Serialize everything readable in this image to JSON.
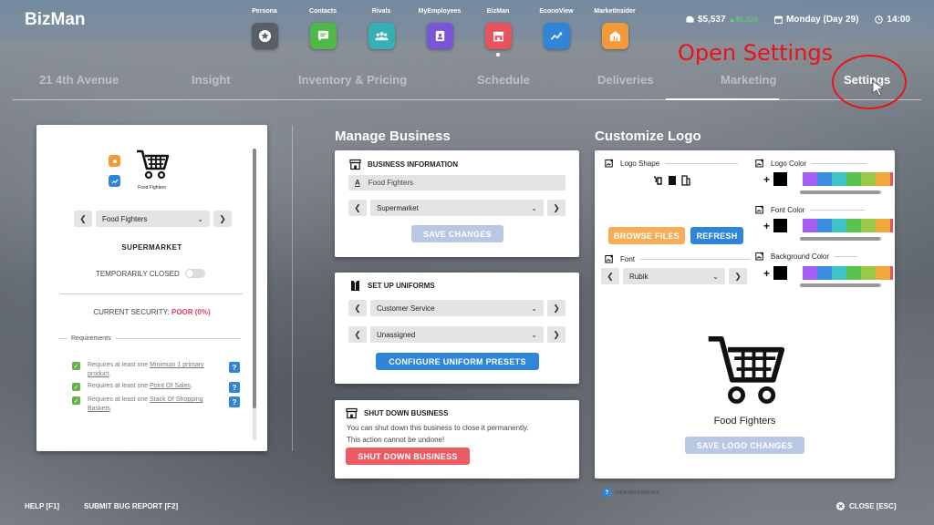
{
  "app": {
    "brand": "BizMan",
    "apps": [
      {
        "label": "Persona",
        "icon": "persona-icon",
        "color": "#5a5f66"
      },
      {
        "label": "Contacts",
        "icon": "contacts-icon",
        "color": "#4fb848"
      },
      {
        "label": "Rivals",
        "icon": "rivals-icon",
        "color": "#35b0b4"
      },
      {
        "label": "MyEmployees",
        "icon": "employees-icon",
        "color": "#7b55d8"
      },
      {
        "label": "BizMan",
        "icon": "bizman-icon",
        "color": "#e8545e"
      },
      {
        "label": "EconoView",
        "icon": "econoview-icon",
        "color": "#2f86d8"
      },
      {
        "label": "MarketInsider",
        "icon": "marketinsider-icon",
        "color": "#f29a3a"
      }
    ],
    "money": "$5,537",
    "money_change": "▲$5,334",
    "day": "Monday (Day 29)",
    "time": "14:00"
  },
  "tabs": [
    "21 4th Avenue",
    "Insight",
    "Inventory & Pricing",
    "Schedule",
    "Deliveries",
    "Marketing",
    "Settings"
  ],
  "annotation": "Open Settings",
  "left_panel": {
    "logo_name": "Food Fighters",
    "business_select": "Food Fighters",
    "type": "SUPERMARKET",
    "closed_label": "TEMPORARILY CLOSED",
    "security_label": "CURRENT SECURITY:",
    "security_value": "POOR (0%)",
    "requirements_label": "Requirements",
    "requirements": [
      {
        "prefix": "Requires at least one ",
        "link": "Minimum 1 primary product",
        "suffix": "."
      },
      {
        "prefix": "Requires at least one ",
        "link": "Point Of Sales",
        "suffix": "."
      },
      {
        "prefix": "Requires at least one ",
        "link": "Stack Of Shopping Baskets",
        "suffix": "."
      }
    ],
    "help_glyph": "?"
  },
  "manage": {
    "title": "Manage Business",
    "info_head": "BUSINESS INFORMATION",
    "name_value": "Food Fighters",
    "name_prefix": "A",
    "type_select": "Supermarket",
    "save_changes": "SAVE CHANGES",
    "uniforms_head": "SET UP UNIFORMS",
    "uniform_role": "Customer Service",
    "uniform_preset": "Unassigned",
    "configure": "CONFIGURE UNIFORM PRESETS",
    "shutdown_head": "SHUT DOWN BUSINESS",
    "shutdown_text_1": "You can shut down this business to close it permanently.",
    "shutdown_text_2": "This action cannot be undone!",
    "shutdown_btn": "SHUT DOWN BUSINESS"
  },
  "logo": {
    "title": "Customize Logo",
    "shape_label": "Logo Shape",
    "logo_color_label": "Logo Color",
    "font_color_label": "Font Color",
    "bg_color_label": "Background Color",
    "browse": "BROWSE FILES",
    "refresh": "REFRESH",
    "font_label": "Font",
    "font_value": "Rubik",
    "caption": "Food Fighters",
    "save": "SAVE LOGO CHANGES",
    "sign_appearance": "SIGN APPEARANCE",
    "plus": "+",
    "swatches": [
      "#a55ef2",
      "#3b8de0",
      "#3fc3c6",
      "#5cc24f",
      "#9ac94a",
      "#f2a93b"
    ],
    "slider_level": 0.98
  },
  "footer": {
    "help": "HELP [F1]",
    "bug": "SUBMIT BUG REPORT [F2]",
    "close": "CLOSE [ESC]"
  }
}
